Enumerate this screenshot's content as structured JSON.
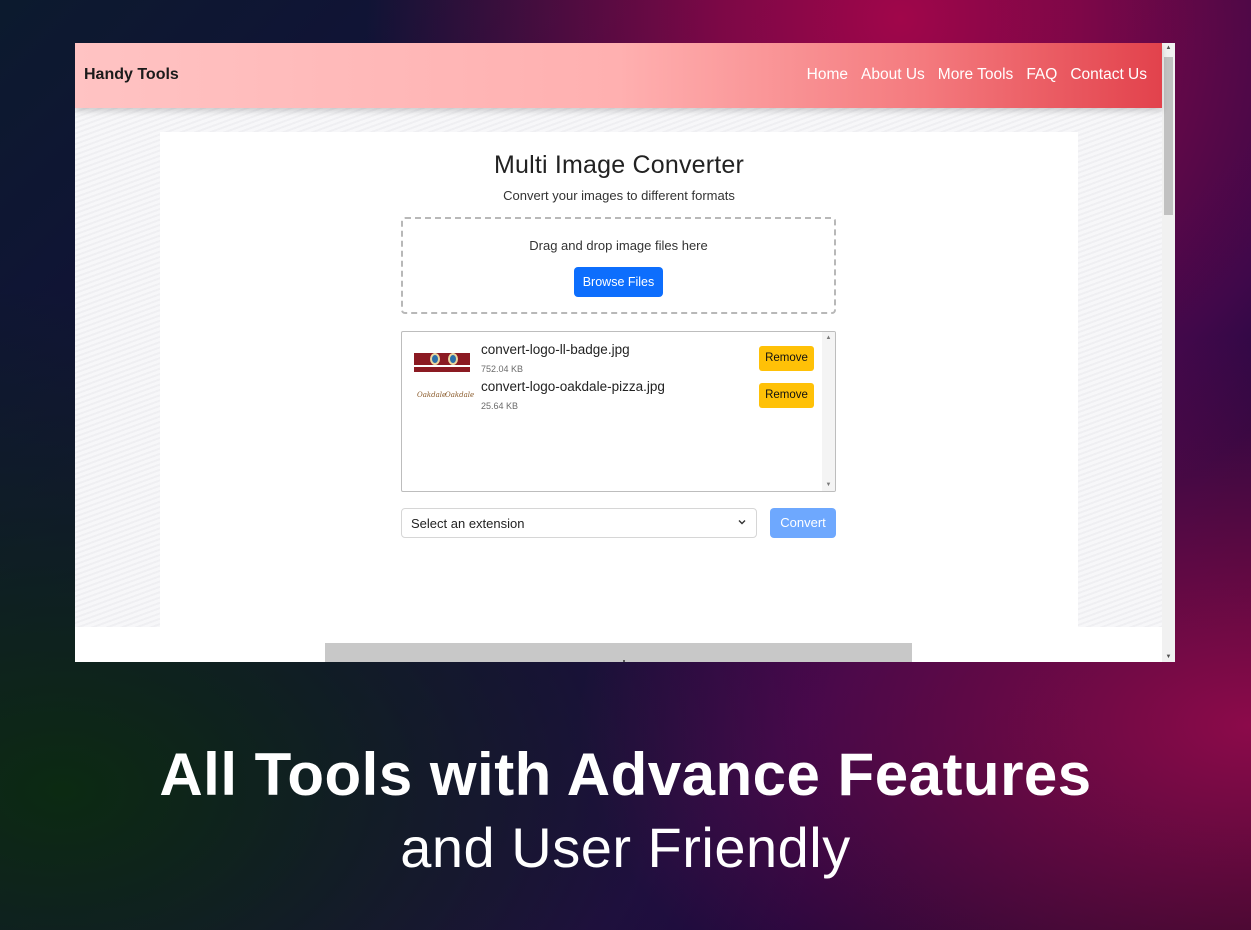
{
  "navbar": {
    "brand": "Handy Tools",
    "links": [
      "Home",
      "About Us",
      "More Tools",
      "FAQ",
      "Contact Us"
    ]
  },
  "converter": {
    "title": "Multi Image Converter",
    "subtitle": "Convert your images to different formats",
    "dropzone_text": "Drag and drop image files here",
    "browse_label": "Browse Files",
    "files": [
      {
        "name": "convert-logo-ll-badge.jpg",
        "size": "752.04 KB",
        "remove_label": "Remove"
      },
      {
        "name": "convert-logo-oakdale-pizza.jpg",
        "size": "25.64 KB",
        "remove_label": "Remove"
      }
    ],
    "extension_select": "Select an extension",
    "convert_label": "Convert"
  },
  "caption": {
    "headline": "All Tools with Advance Features",
    "subline": "and User Friendly"
  },
  "colors": {
    "primary_button": "#0d6efd",
    "remove_button": "#ffc107",
    "convert_button": "#6ea8fe",
    "navbar_accent": "#e2424c"
  },
  "icons": {
    "select_caret": "chevron-down-icon",
    "scroll_up": "scroll-up-arrow-icon",
    "scroll_down": "scroll-down-arrow-icon"
  }
}
